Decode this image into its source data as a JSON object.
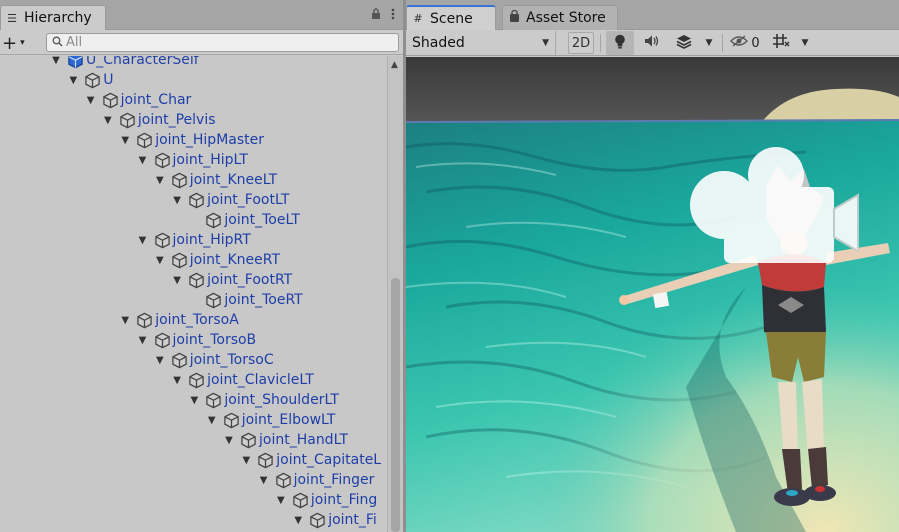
{
  "hierarchy": {
    "tab_label": "Hierarchy",
    "tab_icon": "hierarchy-list-icon",
    "lock_icon": "lock-icon",
    "menu_icon": "kebab-menu-icon",
    "add_label": "+",
    "add_caret": "▾",
    "search_placeholder": "All",
    "rows": [
      {
        "label": "U_CharacterSelf",
        "depth": 0
      },
      {
        "label": "U",
        "depth": 1
      },
      {
        "label": "joint_Char",
        "depth": 2
      },
      {
        "label": "joint_Pelvis",
        "depth": 3
      },
      {
        "label": "joint_HipMaster",
        "depth": 4
      },
      {
        "label": "joint_HipLT",
        "depth": 5
      },
      {
        "label": "joint_KneeLT",
        "depth": 6
      },
      {
        "label": "joint_FootLT",
        "depth": 7
      },
      {
        "label": "joint_ToeLT",
        "depth": 8
      },
      {
        "label": "joint_HipRT",
        "depth": 5
      },
      {
        "label": "joint_KneeRT",
        "depth": 6
      },
      {
        "label": "joint_FootRT",
        "depth": 7
      },
      {
        "label": "joint_ToeRT",
        "depth": 8
      },
      {
        "label": "joint_TorsoA",
        "depth": 4
      },
      {
        "label": "joint_TorsoB",
        "depth": 5
      },
      {
        "label": "joint_TorsoC",
        "depth": 6
      },
      {
        "label": "joint_ClavicleLT",
        "depth": 7
      },
      {
        "label": "joint_ShoulderLT",
        "depth": 8
      },
      {
        "label": "joint_ElbowLT",
        "depth": 9
      },
      {
        "label": "joint_HandLT",
        "depth": 10
      },
      {
        "label": "joint_CapitateL",
        "depth": 11
      },
      {
        "label": "joint_Finger",
        "depth": 12
      },
      {
        "label": "joint_Fing",
        "depth": 13
      },
      {
        "label": "joint_Fi",
        "depth": 14
      },
      {
        "label": "",
        "depth": 15
      }
    ]
  },
  "scene": {
    "tabs": [
      {
        "label": "Scene",
        "icon": "grid-hash-icon",
        "active": true
      },
      {
        "label": "Asset Store",
        "icon": "shopping-bag-icon",
        "active": false
      }
    ],
    "shading_mode": "Shaded",
    "toggle_2d": "2D",
    "hidden_count": "0",
    "icons": {
      "light": "lightbulb-icon",
      "audio": "speaker-icon",
      "effects": "layers-effects-icon",
      "visibility": "eye-slash-icon",
      "gizmo_grid": "grid-toggle-icon"
    }
  }
}
